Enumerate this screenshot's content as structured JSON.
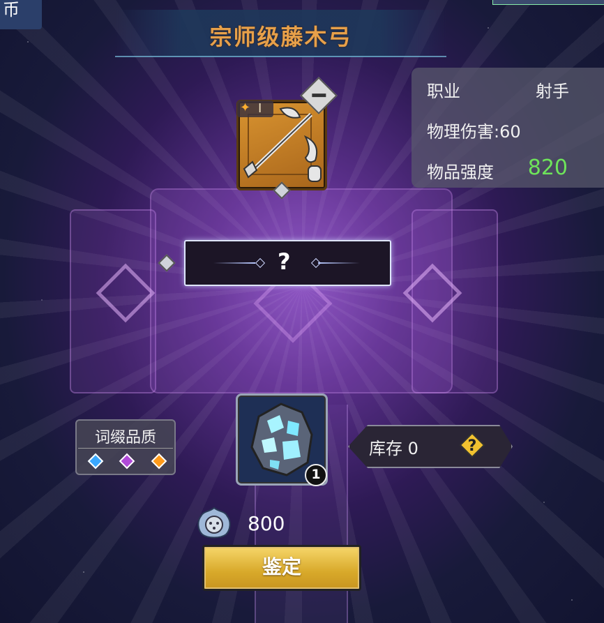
{
  "title": "宗师级藤木弓",
  "corner_text": "币",
  "stats": {
    "profession_label": "职业",
    "profession_value": "射手",
    "physical_damage": "物理伤害:60",
    "item_strength_label": "物品强度",
    "item_strength_value": "820",
    "strength_color": "#6ee45a"
  },
  "weapon": {
    "icon": "bow-icon",
    "level_badge": "I",
    "frame_color": "#d99430"
  },
  "identify_box": {
    "symbol": "?"
  },
  "affix_quality": {
    "title": "词缀品质",
    "gems": [
      "#3aa8ff",
      "#b04ad8",
      "#ff9a1a"
    ]
  },
  "crystal": {
    "icon": "crystal-ore-icon",
    "count": "1"
  },
  "stock": {
    "label": "库存 0",
    "help_icon": "question-icon"
  },
  "cost": {
    "icon": "soul-currency-icon",
    "value": "800"
  },
  "appraise_button": {
    "label": "鉴定"
  }
}
